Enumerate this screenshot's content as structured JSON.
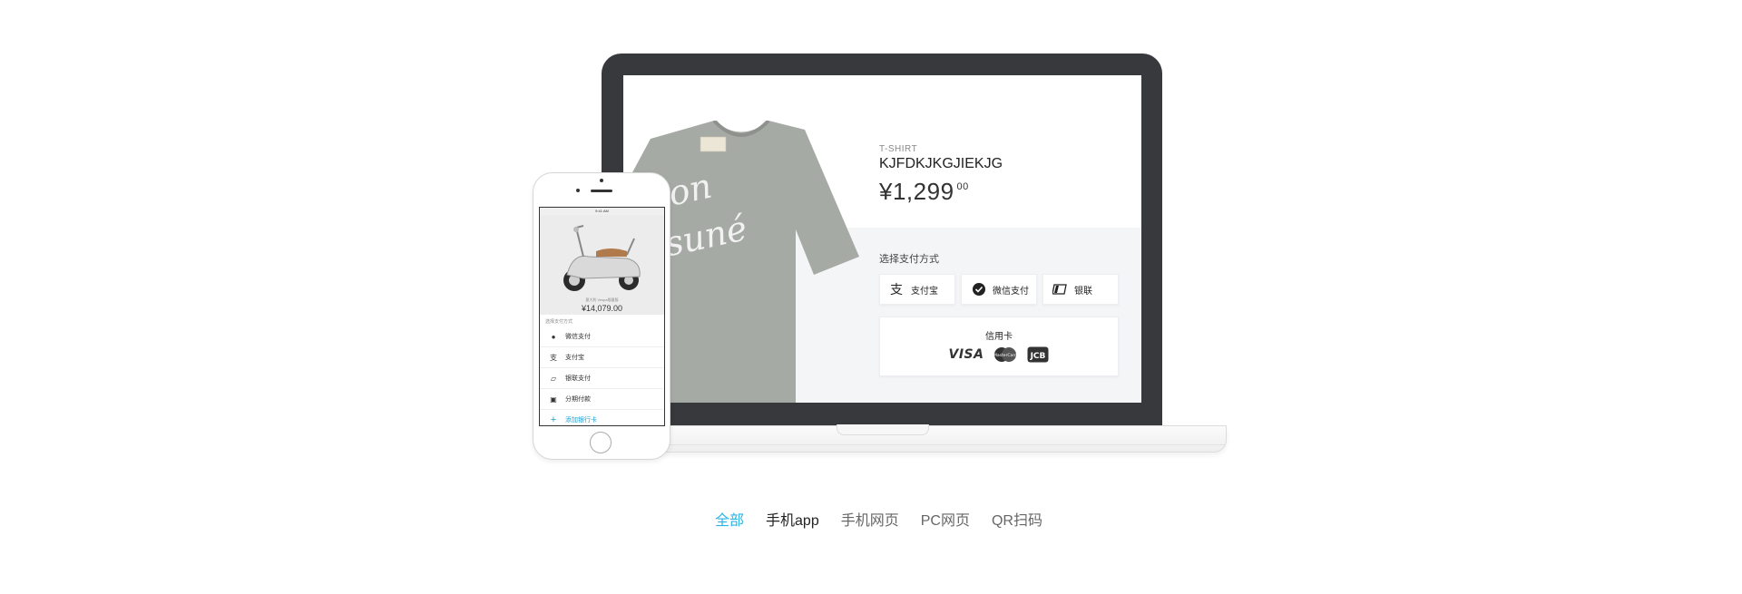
{
  "laptop": {
    "product": {
      "category": "T-SHIRT",
      "name": "KJFDKJKGJIEKJG",
      "price": "¥1,299",
      "price_cents": "00",
      "shirt_print_line1": "aison",
      "shirt_print_line2": "kitsuné",
      "shirt_color": "#a6aaa5"
    },
    "payment": {
      "title": "选择支付方式",
      "methods": [
        {
          "label": "支付宝",
          "icon": "alipay-icon"
        },
        {
          "label": "微信支付",
          "icon": "wechat-pay-icon"
        },
        {
          "label": "银联",
          "icon": "unionpay-icon"
        }
      ],
      "card": {
        "title": "信用卡",
        "logos": [
          "VISA",
          "MasterCard",
          "JCB"
        ]
      }
    }
  },
  "phone": {
    "status_time": "9:41 AM",
    "product_caption": "意大利 Vespa限量版",
    "product_price": "¥14,079.00",
    "payment_title": "选择支付方式",
    "items": [
      {
        "label": "微信支付",
        "icon": "wechat-icon"
      },
      {
        "label": "支付宝",
        "icon": "alipay-icon"
      },
      {
        "label": "银联支付",
        "icon": "unionpay-icon"
      },
      {
        "label": "分期付款",
        "icon": "installment-icon"
      },
      {
        "label": "添加银行卡",
        "icon": "plus-icon"
      }
    ]
  },
  "tabs": [
    {
      "label": "全部",
      "active": true
    },
    {
      "label": "手机app",
      "active": false
    },
    {
      "label": "手机网页",
      "active": false
    },
    {
      "label": "PC网页",
      "active": false
    },
    {
      "label": "QR扫码",
      "active": false
    }
  ],
  "colors": {
    "accent": "#2db4e6",
    "laptop_bezel": "#38393d",
    "panel_bg": "#f4f5f7"
  }
}
